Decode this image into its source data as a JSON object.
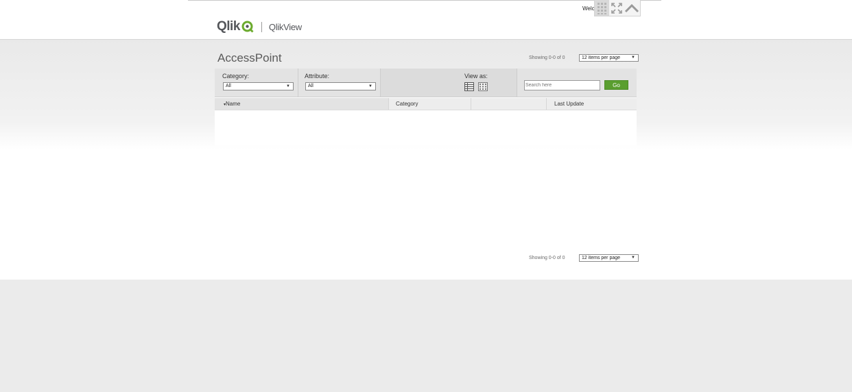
{
  "header": {
    "welcome_text": "Welcome",
    "logo_brand": "Qlik",
    "logo_product": "QlikView",
    "icons": [
      "grid-icon",
      "fullscreen-icon",
      "collapse-up-icon"
    ]
  },
  "main": {
    "title": "AccessPoint",
    "pagination_top": {
      "showing": "Showing 0-0 of 0",
      "per_page": "12 items per page"
    },
    "pagination_bottom": {
      "showing": "Showing 0-0 of 0",
      "per_page": "12 items per page"
    }
  },
  "filters": {
    "category_label": "Category:",
    "category_value": "All",
    "attribute_label": "Attribute:",
    "attribute_value": "All",
    "view_as_label": "View as:",
    "search_placeholder": "Search here",
    "go_label": "Go"
  },
  "table": {
    "columns": [
      "Name",
      "Category",
      "",
      "Last Update"
    ],
    "sort_indicator": "▾"
  },
  "colors": {
    "accent_green": "#5a9e2f",
    "logo_green": "#6cab2e"
  }
}
